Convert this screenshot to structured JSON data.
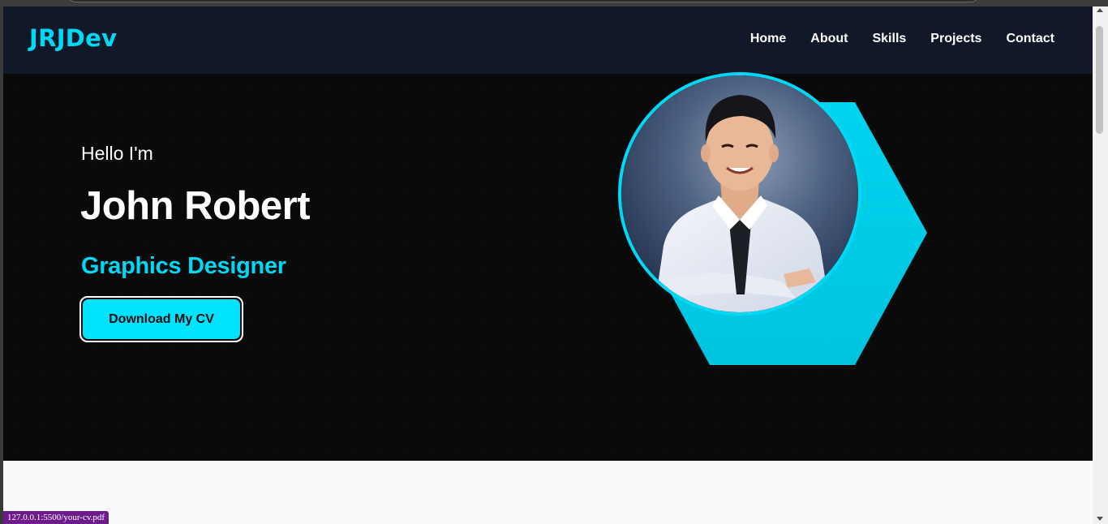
{
  "navbar": {
    "logo": "JRJDev",
    "links": [
      "Home",
      "About",
      "Skills",
      "Projects",
      "Contact"
    ]
  },
  "hero": {
    "greeting": "Hello I'm",
    "name": "John Robert",
    "role": "Graphics Designer",
    "cta_label": "Download My CV"
  },
  "status_bar": {
    "hover_url": "127.0.0.1:5500/your-cv.pdf"
  },
  "colors": {
    "accent": "#00d9f5",
    "button": "#00e3ff",
    "nav_bg": "#111827",
    "hero_bg": "#0a0a0b",
    "section_bg": "#f8fafc"
  },
  "icons": {
    "profile_photo": "person-portrait",
    "scroll_up": "triangle-up-icon",
    "scroll_down": "triangle-down-icon"
  }
}
